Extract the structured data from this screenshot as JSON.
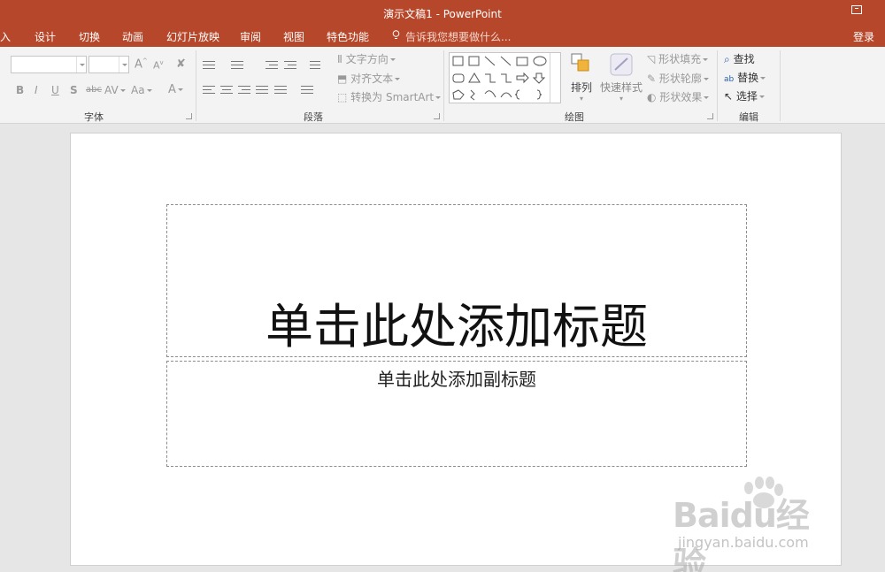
{
  "window": {
    "title": "演示文稿1 - PowerPoint",
    "login": "登录"
  },
  "menu": {
    "tabs": [
      "入",
      "设计",
      "切换",
      "动画",
      "幻灯片放映",
      "审阅",
      "视图",
      "特色功能"
    ],
    "tell_me": "告诉我您想要做什么..."
  },
  "ribbon": {
    "font_group": {
      "label": "字体",
      "bold": "B",
      "italic": "I",
      "underline": "U",
      "shadow": "S",
      "strike": "abc",
      "spacing": "AV",
      "case": "Aa",
      "color": "A",
      "grow": "A",
      "shrink": "A"
    },
    "paragraph_group": {
      "label": "段落",
      "text_direction": "文字方向",
      "align_text": "对齐文本",
      "smartart": "转换为 SmartArt"
    },
    "drawing_group": {
      "label": "绘图",
      "arrange": "排列",
      "quick_styles": "快速样式",
      "shape_fill": "形状填充",
      "shape_outline": "形状轮廓",
      "shape_effects": "形状效果"
    },
    "editing_group": {
      "label": "编辑",
      "find": "查找",
      "replace": "替换",
      "select": "选择"
    }
  },
  "slide": {
    "title_placeholder": "单击此处添加标题",
    "subtitle_placeholder": "单击此处添加副标题"
  },
  "watermark": {
    "brand": "Baidu经验",
    "url": "jingyan.baidu.com"
  },
  "colors": {
    "accent": "#b7472a",
    "ribbon_bg": "#f3f3f3",
    "workspace_bg": "#e6e6e6"
  }
}
